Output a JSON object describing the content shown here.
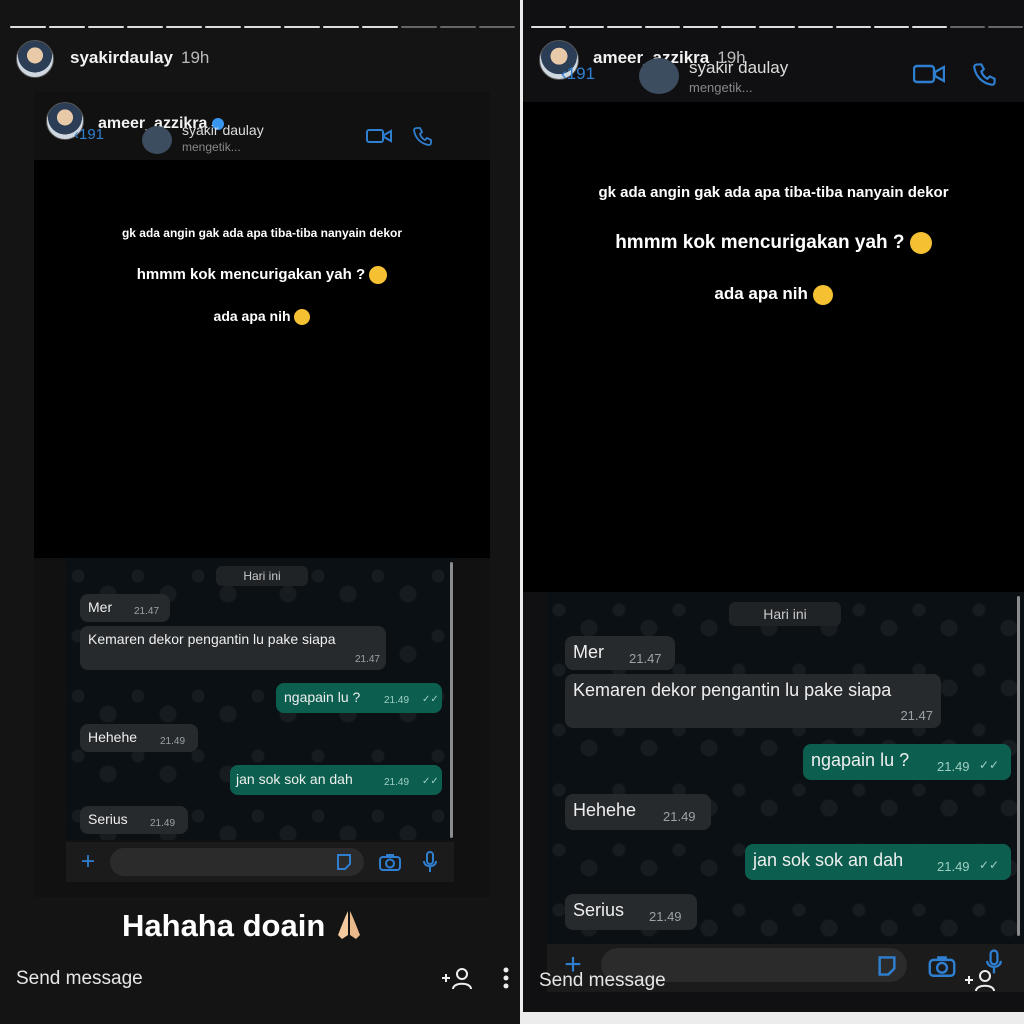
{
  "left_story": {
    "username": "syakirdaulay",
    "time": "19h",
    "caption": "Hahaha doain",
    "send_message": "Send message"
  },
  "right_story": {
    "username": "ameer_azzikra",
    "time": "19h",
    "send_message": "Send message"
  },
  "embedded_story": {
    "username": "ameer_azzikra"
  },
  "whatsapp": {
    "back_count": "191",
    "contact_name": "syakir daulay",
    "status": "mengetik..."
  },
  "overlay": {
    "line1": "gk ada angin gak ada apa tiba-tiba nanyain dekor",
    "line2": "hmmm kok mencurigakan yah ?",
    "line3": "ada apa nih"
  },
  "chat": {
    "date_label": "Hari ini",
    "messages": [
      {
        "dir": "in",
        "text": "Mer",
        "time": "21.47"
      },
      {
        "dir": "in",
        "text": "Kemaren dekor pengantin lu pake siapa",
        "time": "21.47"
      },
      {
        "dir": "out",
        "text": "ngapain lu ?",
        "time": "21.49"
      },
      {
        "dir": "in",
        "text": "Hehehe",
        "time": "21.49"
      },
      {
        "dir": "out",
        "text": "jan sok sok an dah",
        "time": "21.49"
      },
      {
        "dir": "in",
        "text": "Serius",
        "time": "21.49"
      }
    ]
  },
  "icons": {
    "video": "video-call-icon",
    "phone": "phone-icon",
    "plus": "plus-icon",
    "sticker": "sticker-icon",
    "camera": "camera-icon",
    "mic": "mic-icon",
    "add_friend": "add-person-icon",
    "more": "more-vertical-icon",
    "verified": "verified-badge-icon",
    "emoji_thinking": "thinking-emoji",
    "emoji_pray": "praying-hands-emoji"
  },
  "colors": {
    "outgoing_bubble": "#0c5f4f",
    "incoming_bubble": "#262a2d",
    "accent_blue": "#2f7fd0"
  }
}
